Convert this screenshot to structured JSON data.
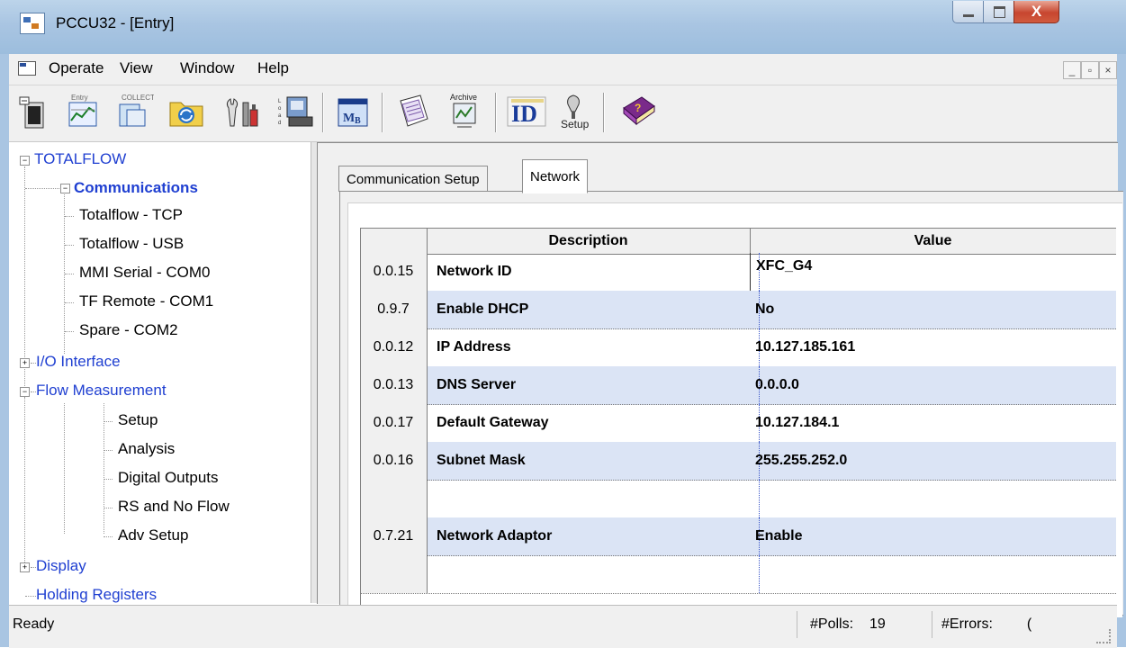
{
  "window": {
    "title": "PCCU32 - [Entry]",
    "controls": {
      "minimize": "—",
      "maximize": "□",
      "close": "X"
    }
  },
  "menu": {
    "items": [
      "Operate",
      "View",
      "Window",
      "Help"
    ],
    "mdi_controls": [
      "_",
      "▫",
      "×"
    ]
  },
  "toolbar": {
    "buttons": [
      {
        "icon": "device-icon",
        "label": ""
      },
      {
        "icon": "entry-icon",
        "label": "Entry"
      },
      {
        "icon": "collect-icon",
        "label": "COLLECT"
      },
      {
        "icon": "sync-folder-icon",
        "label": ""
      },
      {
        "icon": "tools-icon",
        "label": ""
      },
      {
        "icon": "load-icon",
        "label": "L o a d"
      },
      {
        "icon": "modbus-icon",
        "label": "MB"
      },
      {
        "icon": "reports-icon",
        "label": ""
      },
      {
        "icon": "archive-icon",
        "label": "Archive"
      },
      {
        "icon": "id-manager-icon",
        "label": "ID"
      },
      {
        "icon": "setup-icon",
        "label": "Setup"
      },
      {
        "icon": "help-book-icon",
        "label": ""
      }
    ]
  },
  "tree": {
    "root": "TOTALFLOW",
    "communications": "Communications",
    "comm_children": [
      "Totalflow - TCP",
      "Totalflow - USB",
      "MMI Serial - COM0",
      "TF Remote - COM1",
      "Spare - COM2"
    ],
    "io_interface": "I/O Interface",
    "flow_measurement": "Flow Measurement",
    "flow_children": [
      "Setup",
      "Analysis",
      "Digital Outputs",
      "RS and No Flow",
      "Adv Setup"
    ],
    "display": "Display",
    "holding_registers": "Holding Registers"
  },
  "tabs": [
    "Communication Setup",
    "Network"
  ],
  "active_tab": "Network",
  "grid": {
    "headers": [
      "",
      "Description",
      "Value"
    ],
    "rows": [
      {
        "reg": "0.0.15",
        "desc": "Network ID",
        "value": "XFC_G4"
      },
      {
        "reg": "0.9.7",
        "desc": "Enable DHCP",
        "value": "No"
      },
      {
        "reg": "0.0.12",
        "desc": "IP Address",
        "value": "10.127.185.161"
      },
      {
        "reg": "0.0.13",
        "desc": "DNS Server",
        "value": "0.0.0.0"
      },
      {
        "reg": "0.0.17",
        "desc": "Default Gateway",
        "value": "10.127.184.1"
      },
      {
        "reg": "0.0.16",
        "desc": "Subnet Mask",
        "value": "255.255.252.0"
      },
      {
        "reg": "",
        "desc": "",
        "value": ""
      },
      {
        "reg": "0.7.21",
        "desc": "Network Adaptor",
        "value": "Enable"
      },
      {
        "reg": "",
        "desc": "",
        "value": ""
      }
    ]
  },
  "status": {
    "ready": "Ready",
    "polls_label": "#Polls:",
    "polls_value": "19",
    "errors_label": "#Errors:",
    "errors_value": "("
  },
  "colors": {
    "tree_link": "#1f3fd1",
    "row_highlight": "#dbe4f5",
    "titlebar": "#a9c5e2"
  }
}
